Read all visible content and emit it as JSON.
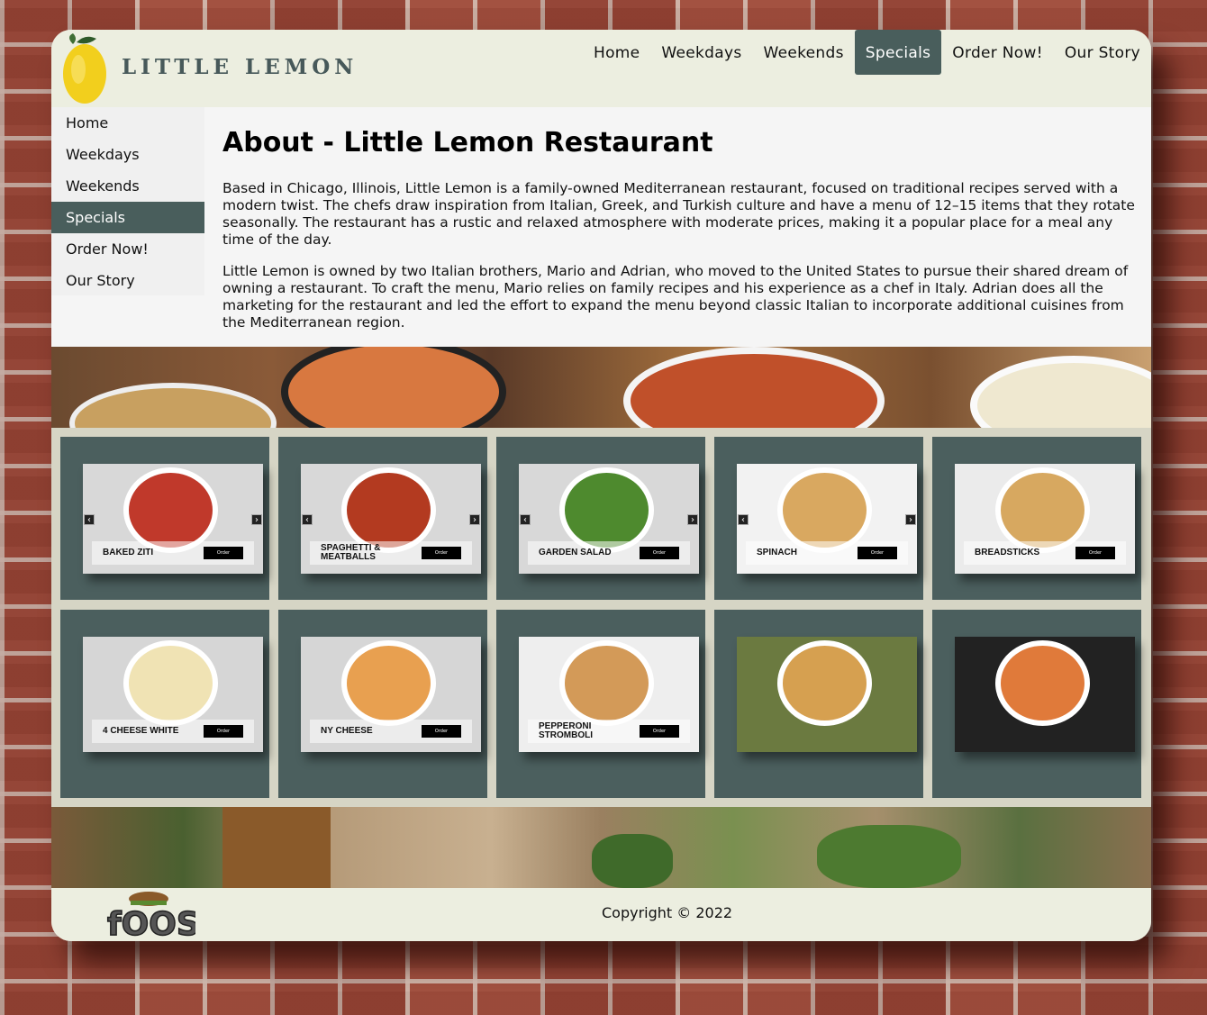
{
  "brand": "LITTLE LEMON",
  "topnav": [
    {
      "label": "Home",
      "active": false
    },
    {
      "label": "Weekdays",
      "active": false
    },
    {
      "label": "Weekends",
      "active": false
    },
    {
      "label": "Specials",
      "active": true
    },
    {
      "label": "Order Now!",
      "active": false
    },
    {
      "label": "Our Story",
      "active": false
    }
  ],
  "sidenav": [
    {
      "label": "Home",
      "active": false
    },
    {
      "label": "Weekdays",
      "active": false
    },
    {
      "label": "Weekends",
      "active": false
    },
    {
      "label": "Specials",
      "active": true
    },
    {
      "label": "Order Now!",
      "active": false
    },
    {
      "label": "Our Story",
      "active": false
    }
  ],
  "main": {
    "title": "About - Little Lemon Restaurant",
    "para1": "Based in Chicago, Illinois, Little Lemon is a family-owned Mediterranean restaurant, focused on traditional recipes served with a modern twist. The chefs draw inspiration from Italian, Greek, and Turkish culture and have a menu of 12–15 items that they rotate seasonally. The restaurant has a rustic and relaxed atmosphere with moderate prices, making it a popular place for a meal any time of the day.",
    "para2": "Little Lemon is owned by two Italian brothers, Mario and Adrian, who moved to the United States to pursue their shared dream of owning a restaurant. To craft the menu, Mario relies on family recipes and his experience as a chef in Italy. Adrian does all the marketing for the restaurant and led the effort to expand the menu beyond classic Italian to incorporate additional cuisines from the Mediterranean region."
  },
  "specials": [
    {
      "label": "BAKED ZITI",
      "button": "Order",
      "arrows": true,
      "colors": [
        "#d8d8d8",
        "#c0392b"
      ]
    },
    {
      "label": "SPAGHETTI & MEATBALLS",
      "button": "Order",
      "arrows": true,
      "colors": [
        "#d8d8d8",
        "#b33a20"
      ]
    },
    {
      "label": "GARDEN SALAD",
      "button": "Order",
      "arrows": true,
      "colors": [
        "#d8d8d8",
        "#4e8a2e"
      ]
    },
    {
      "label": "SPINACH",
      "button": "Order",
      "arrows": true,
      "colors": [
        "#f2f2f2",
        "#d9a860"
      ]
    },
    {
      "label": "BREADSTICKS",
      "button": "Order",
      "arrows": false,
      "colors": [
        "#ebebeb",
        "#d7a860"
      ]
    },
    {
      "label": "4 CHEESE WHITE",
      "button": "Order",
      "arrows": false,
      "colors": [
        "#d6d6d6",
        "#f0e3b4"
      ]
    },
    {
      "label": "NY CHEESE",
      "button": "Order",
      "arrows": false,
      "colors": [
        "#d6d6d6",
        "#e8a050"
      ]
    },
    {
      "label": "PEPPERONI STROMBOLI",
      "button": "Order",
      "arrows": false,
      "colors": [
        "#eeeeee",
        "#d39a58"
      ]
    },
    {
      "label": "",
      "button": "",
      "arrows": false,
      "colors": [
        "#6b7a40",
        "#d6a050"
      ]
    },
    {
      "label": "",
      "button": "",
      "arrows": false,
      "colors": [
        "#222222",
        "#e07a3a"
      ]
    }
  ],
  "footer": {
    "copyright": "Copyright © 2022"
  }
}
